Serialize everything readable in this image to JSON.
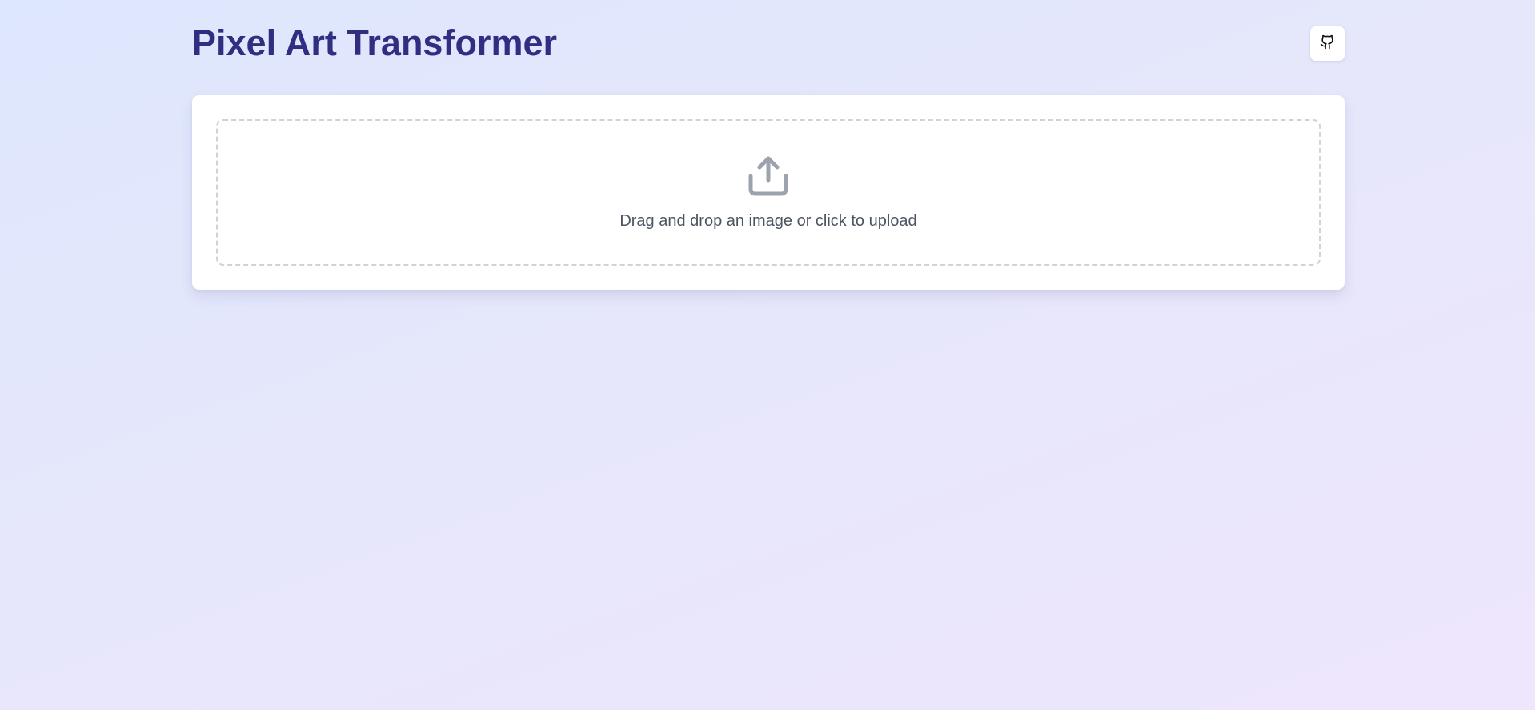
{
  "header": {
    "title": "Pixel Art Transformer",
    "github_icon": "github-icon"
  },
  "upload": {
    "icon": "upload-icon",
    "prompt": "Drag and drop an image or click to upload"
  },
  "colors": {
    "title": "#312e81",
    "icon": "#9ca3af",
    "prompt_text": "#4b5563",
    "dropzone_border": "#cfd2d8",
    "card_background": "#ffffff"
  }
}
